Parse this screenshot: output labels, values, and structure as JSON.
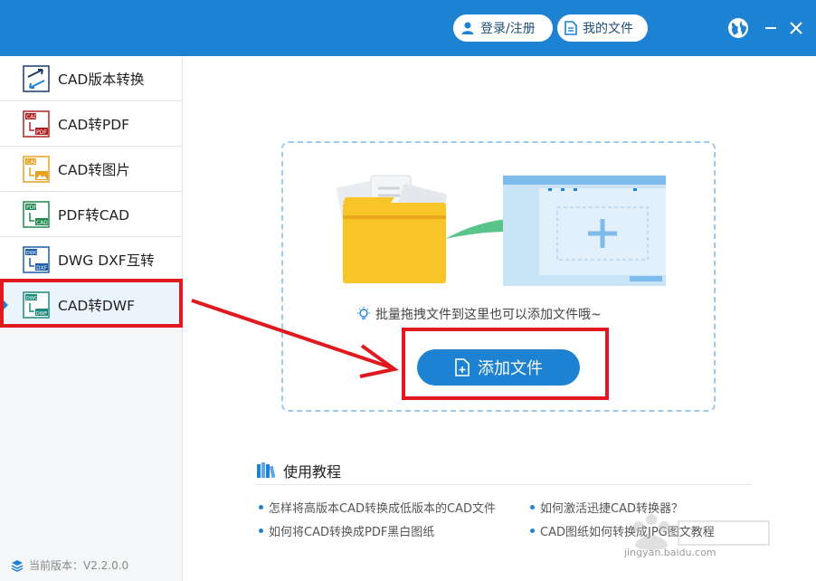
{
  "header": {
    "login_label": "登录/注册",
    "my_files_label": "我的文件",
    "colors": {
      "bar": "#1e82d2"
    }
  },
  "sidebar": {
    "items": [
      {
        "label": "CAD版本转换",
        "icon": "cad-version-icon"
      },
      {
        "label": "CAD转PDF",
        "icon": "cad-to-pdf-icon"
      },
      {
        "label": "CAD转图片",
        "icon": "cad-to-image-icon"
      },
      {
        "label": "PDF转CAD",
        "icon": "pdf-to-cad-icon"
      },
      {
        "label": "DWG DXF互转",
        "icon": "dwg-dxf-icon"
      },
      {
        "label": "CAD转DWF",
        "icon": "cad-to-dwf-icon",
        "active": true
      }
    ],
    "version": "当前版本：V2.2.0.0"
  },
  "dropzone": {
    "hint": "批量拖拽文件到这里也可以添加文件哦~",
    "add_button": "添加文件"
  },
  "tutorial": {
    "title": "使用教程",
    "links": [
      "怎样将高版本CAD转换成低版本的CAD文件",
      "如何激活迅捷CAD转换器？",
      "如何将CAD转换成PDF黑白图纸",
      "CAD图纸如何转换成JPG图文教程"
    ]
  },
  "watermark": {
    "text": "jingyan.baidu.com"
  }
}
